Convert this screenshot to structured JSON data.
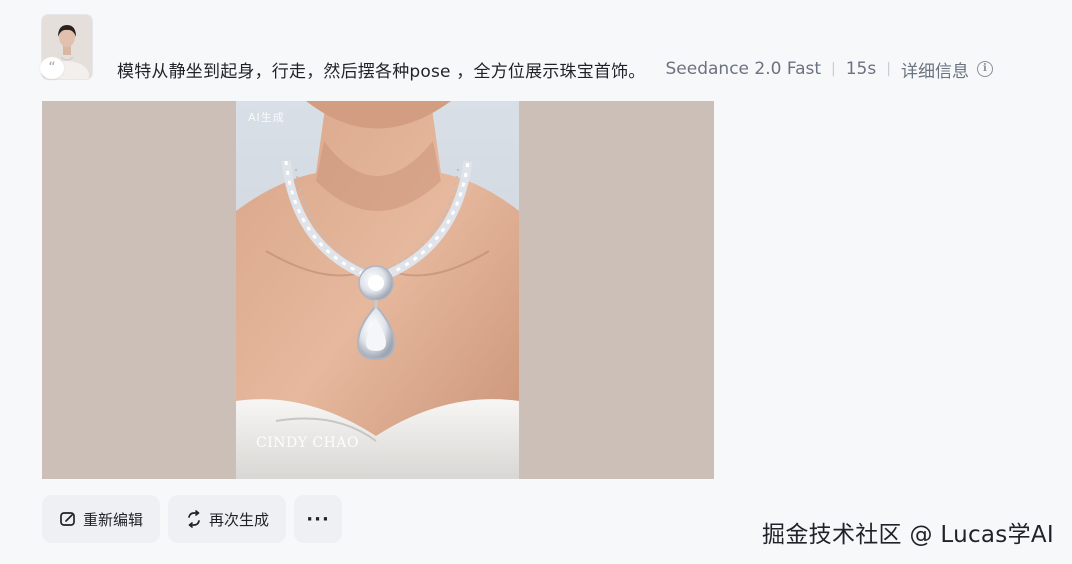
{
  "prompt": {
    "avatar_icon": "model-portrait-thumbnail",
    "quote_icon_glyph": "“",
    "text": "模特从静坐到起身，行走，然后摆各种pose ，全方位展示珠宝首饰。",
    "model": "Seedance 2.0 Fast",
    "separator": "|",
    "duration": "15s",
    "details_label": "详细信息",
    "info_icon_glyph": "i"
  },
  "video": {
    "ai_label": "AI生成",
    "brand_label": "CINDY CHAO"
  },
  "actions": {
    "re_edit_label": "重新编辑",
    "regenerate_label": "再次生成",
    "more_label": "···"
  },
  "watermark": "掘金技术社区 @ Lucas学AI"
}
